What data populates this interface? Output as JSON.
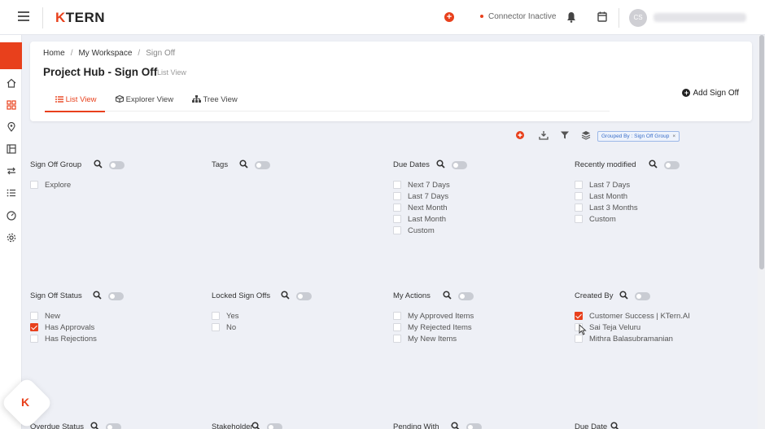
{
  "topbar": {
    "logo_k": "K",
    "logo_rest": "TERN",
    "connector_status": "Connector Inactive",
    "avatar_initials": "CS"
  },
  "breadcrumb": {
    "home": "Home",
    "workspace": "My Workspace",
    "current": "Sign Off"
  },
  "page": {
    "title": "Project Hub - Sign Off",
    "subtitle": "List View",
    "add_button": "Add Sign Off"
  },
  "tabs": [
    {
      "label": "List View"
    },
    {
      "label": "Explorer View"
    },
    {
      "label": "Tree View"
    }
  ],
  "toolbar": {
    "group_chip": "Grouped By : Sign Off Group"
  },
  "groups": [
    {
      "title": "Sign Off Group",
      "options": [
        {
          "label": "Explore",
          "checked": false
        }
      ]
    },
    {
      "title": "Tags",
      "options": []
    },
    {
      "title": "Due Dates",
      "options": [
        {
          "label": "Next 7 Days",
          "checked": false
        },
        {
          "label": "Last 7 Days",
          "checked": false
        },
        {
          "label": "Next Month",
          "checked": false
        },
        {
          "label": "Last Month",
          "checked": false
        },
        {
          "label": "Custom",
          "checked": false
        }
      ]
    },
    {
      "title": "Recently modified",
      "options": [
        {
          "label": "Last 7 Days",
          "checked": false
        },
        {
          "label": "Last Month",
          "checked": false
        },
        {
          "label": "Last 3 Months",
          "checked": false
        },
        {
          "label": "Custom",
          "checked": false
        }
      ]
    },
    {
      "title": "Sign Off Status",
      "options": [
        {
          "label": "New",
          "checked": false
        },
        {
          "label": "Has Approvals",
          "checked": true
        },
        {
          "label": "Has Rejections",
          "checked": false
        }
      ]
    },
    {
      "title": "Locked Sign Offs",
      "options": [
        {
          "label": "Yes",
          "checked": false
        },
        {
          "label": "No",
          "checked": false
        }
      ]
    },
    {
      "title": "My Actions",
      "options": [
        {
          "label": "My Approved Items",
          "checked": false
        },
        {
          "label": "My Rejected Items",
          "checked": false
        },
        {
          "label": "My New Items",
          "checked": false
        }
      ]
    },
    {
      "title": "Created By",
      "options": [
        {
          "label": "Customer Success | KTern.AI",
          "checked": true
        },
        {
          "label": "Sai Teja Veluru",
          "checked": false
        },
        {
          "label": "Mithra Balasubramanian",
          "checked": false
        }
      ]
    },
    {
      "title": "Overdue Status",
      "options": []
    },
    {
      "title": "Stakeholder",
      "options": []
    },
    {
      "title": "Pending With",
      "options": []
    },
    {
      "title": "Due Date",
      "options": []
    }
  ],
  "fab": {
    "letter": "K"
  },
  "colors": {
    "accent": "#e8401c",
    "background": "#eef0f6"
  }
}
